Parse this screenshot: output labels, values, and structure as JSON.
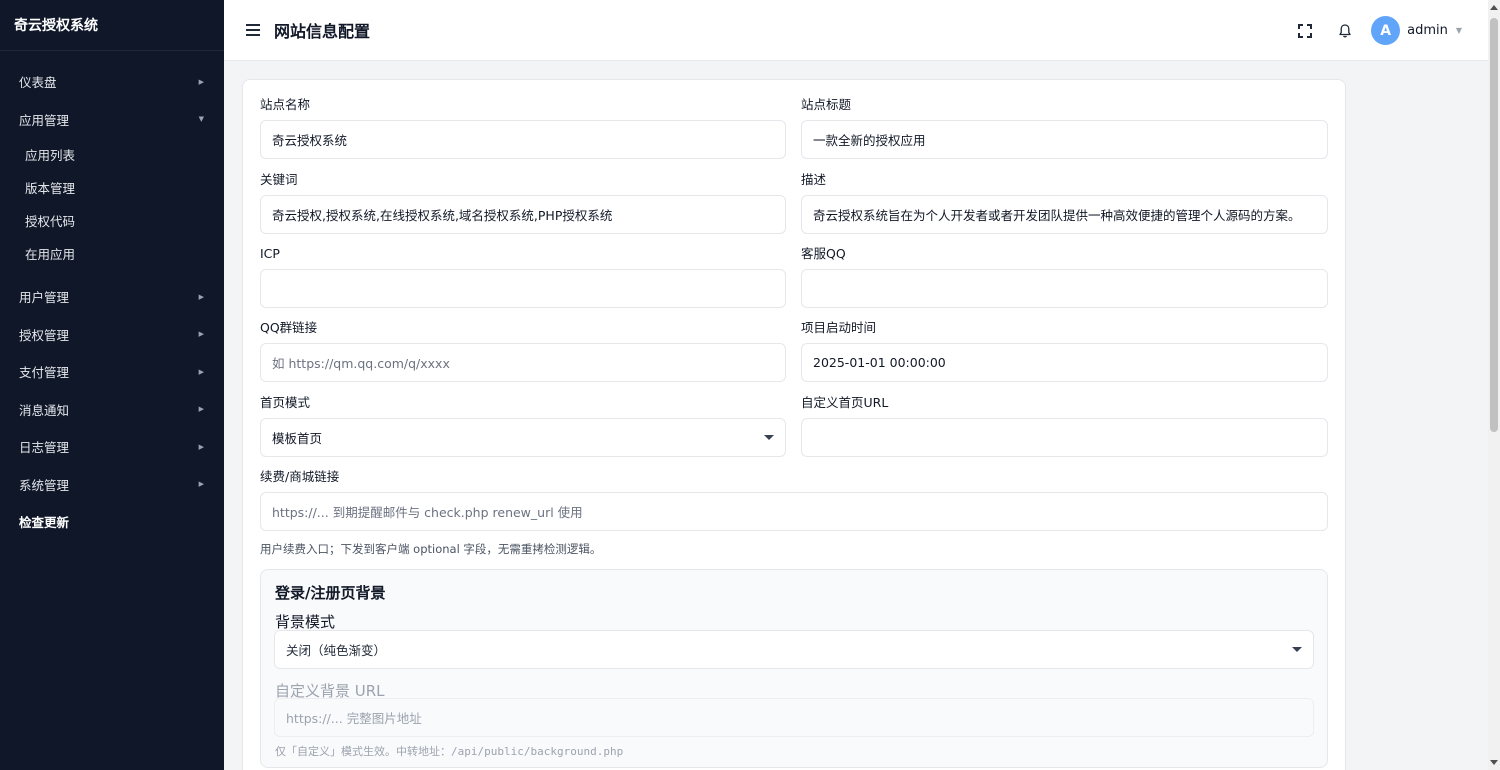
{
  "sidebar": {
    "brand": "奇云授权系统",
    "items": [
      {
        "label": "仪表盘"
      },
      {
        "label": "应用管理"
      },
      {
        "label": "用户管理"
      },
      {
        "label": "授权管理"
      },
      {
        "label": "支付管理"
      },
      {
        "label": "消息通知"
      },
      {
        "label": "日志管理"
      },
      {
        "label": "系统管理"
      },
      {
        "label": "检查更新"
      }
    ],
    "sub_items": [
      {
        "label": "应用列表"
      },
      {
        "label": "版本管理"
      },
      {
        "label": "授权代码"
      },
      {
        "label": "在用应用"
      }
    ]
  },
  "header": {
    "title": "网站信息配置",
    "avatar_letter": "A",
    "username": "admin",
    "icons": [
      "menu-icon",
      "fullscreen-icon",
      "bell-icon"
    ]
  },
  "form": {
    "site_name": {
      "label": "站点名称",
      "value": "奇云授权系统"
    },
    "site_title": {
      "label": "站点标题",
      "value": "一款全新的授权应用"
    },
    "keywords": {
      "label": "关键词",
      "value": "奇云授权,授权系统,在线授权系统,域名授权系统,PHP授权系统"
    },
    "description": {
      "label": "描述",
      "value": "奇云授权系统旨在为个人开发者或者开发团队提供一种高效便捷的管理个人源码的方案。"
    },
    "icp": {
      "label": "ICP",
      "value": ""
    },
    "qq": {
      "label": "客服QQ",
      "value": ""
    },
    "qq_group": {
      "label": "QQ群链接",
      "placeholder": "如 https://qm.qq.com/q/xxxx"
    },
    "start_time": {
      "label": "项目启动时间",
      "value": "2025-01-01 00:00:00"
    },
    "home_mode": {
      "label": "首页模式",
      "value": "模板首页"
    },
    "custom_home_url": {
      "label": "自定义首页URL",
      "value": ""
    },
    "renew_link": {
      "label": "续费/商城链接",
      "placeholder": "https://... 到期提醒邮件与 check.php renew_url 使用"
    },
    "renew_hint": "用户续费入口；下发到客户端 optional 字段，无需重拷检测逻辑。"
  },
  "background_panel": {
    "title": "登录/注册页背景",
    "mode_label": "背景模式",
    "mode_value": "关闭（纯色渐变）",
    "url_label": "自定义背景 URL",
    "url_placeholder": "https://... 完整图片地址",
    "hint": "仅「自定义」模式生效。中转地址：/api/public/background.php"
  }
}
